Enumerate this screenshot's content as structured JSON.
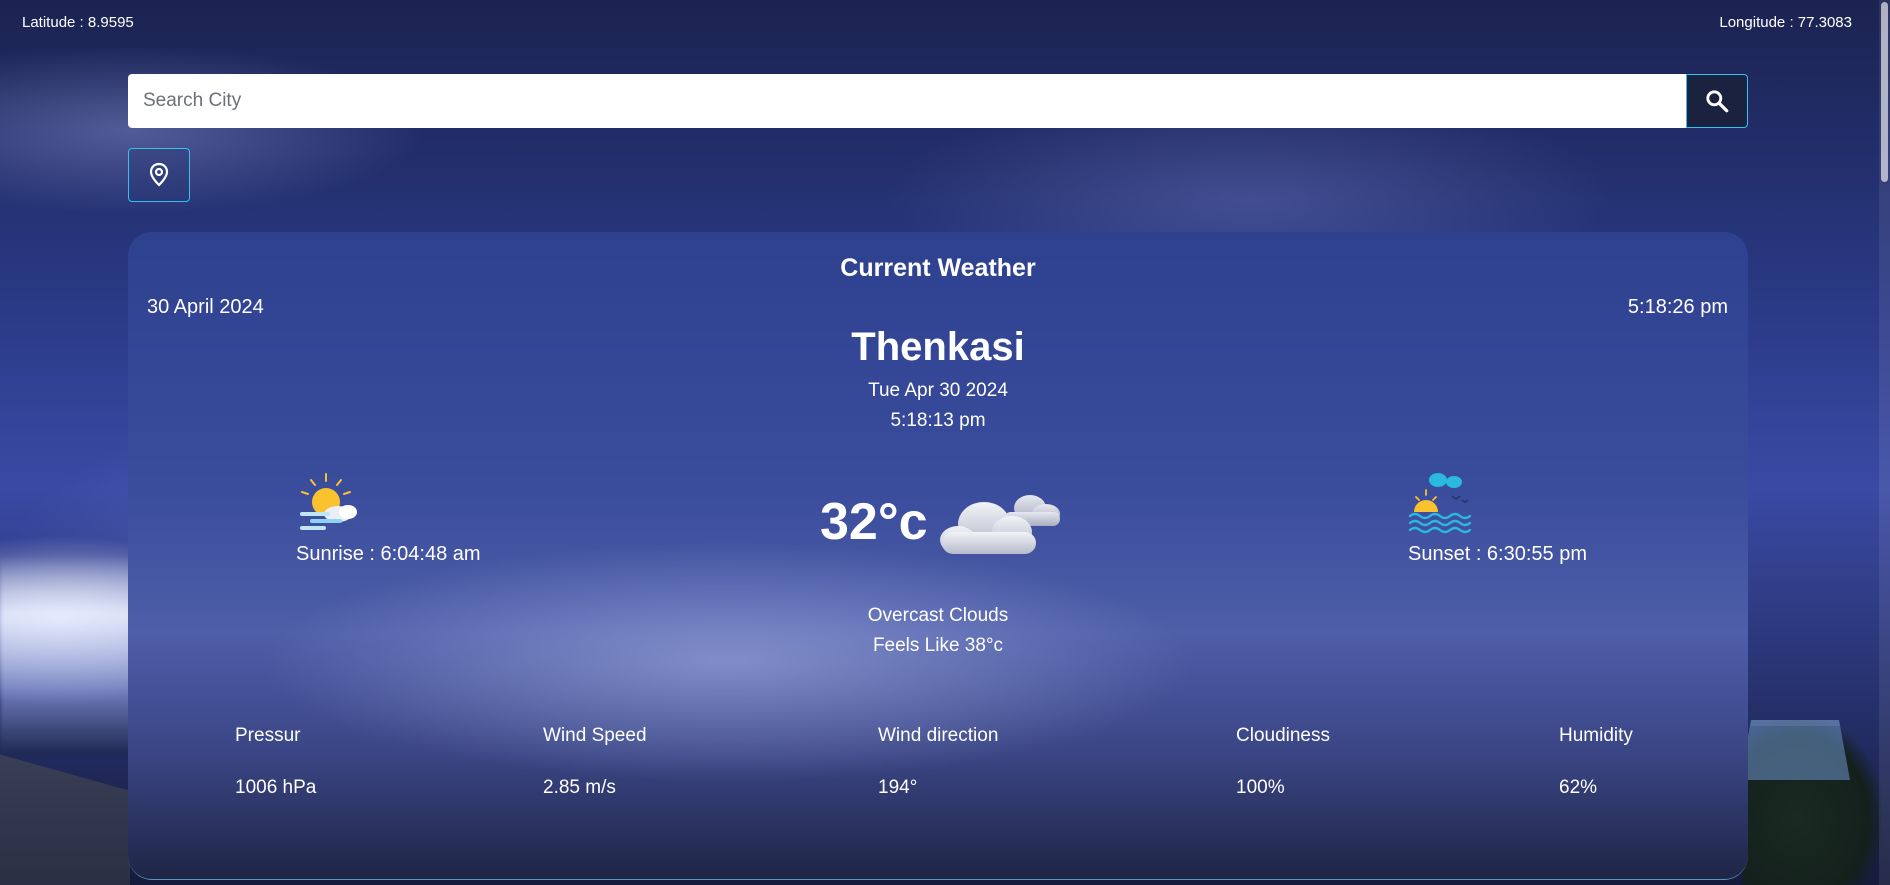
{
  "coords": {
    "latitude": "Latitude : 8.9595",
    "longitude": "Longitude : 77.3083"
  },
  "search": {
    "placeholder": "Search City",
    "button_icon": "search-icon"
  },
  "location_button": {
    "icon": "location-pin-icon"
  },
  "card": {
    "title": "Current Weather",
    "date": "30 April 2024",
    "time": "5:18:26 pm",
    "city": "Thenkasi",
    "full_date": "Tue Apr 30 2024",
    "full_time": "5:18:13 pm",
    "sunrise": "Sunrise : 6:04:48 am",
    "sunset": "Sunset : 6:30:55 pm",
    "temperature": "32°c",
    "condition": "Overcast Clouds",
    "feels_like": "Feels Like 38°c",
    "weather_icon": "overcast-clouds-icon",
    "stats": [
      {
        "label": "Pressur",
        "value": "1006 hPa"
      },
      {
        "label": "Wind Speed",
        "value": "2.85 m/s"
      },
      {
        "label": "Wind direction",
        "value": "194°"
      },
      {
        "label": "Cloudiness",
        "value": "100%"
      },
      {
        "label": "Humidity",
        "value": "62%"
      }
    ]
  },
  "colors": {
    "accent_border": "#31c4e8",
    "search_button_bg": "#1b2240",
    "card_top": "#2e418f",
    "sun_yellow": "#f9c22e"
  }
}
